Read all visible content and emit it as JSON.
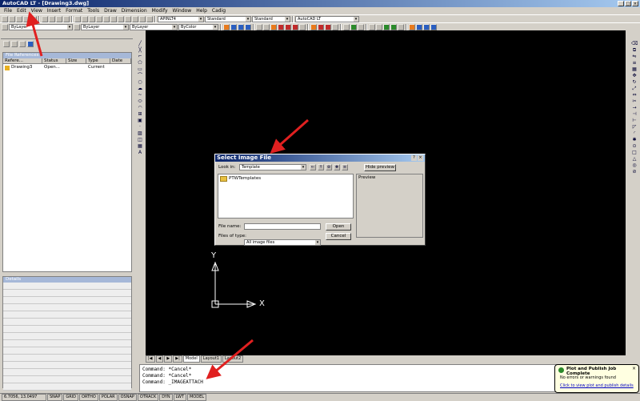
{
  "window": {
    "title": "AutoCAD LT - [Drawing3.dwg]",
    "minimize": "_",
    "maximize": "□",
    "close": "×"
  },
  "menu": [
    "File",
    "Edit",
    "View",
    "Insert",
    "Format",
    "Tools",
    "Draw",
    "Dimension",
    "Modify",
    "Window",
    "Help",
    "Cadig"
  ],
  "toolbar": {
    "layer_combo": "APINLT4",
    "text_style": "Standard",
    "dim_style": "Standard",
    "workspace": "AutoCAD LT",
    "layer_dropdown": "ByLayer",
    "linetype": "ByLayer",
    "lineweight": "ByLayer",
    "color": "ByColor"
  },
  "xref_panel": {
    "title": "File References",
    "columns": [
      "Refere...",
      "Status",
      "Size",
      "Type",
      "Date"
    ],
    "rows": [
      {
        "name": "Drawing3",
        "status": "Open...",
        "size": "",
        "type": "Current",
        "date": ""
      }
    ]
  },
  "details_panel": {
    "title": "Details"
  },
  "dialog": {
    "title": "Select Image File",
    "look_in_label": "Look in:",
    "look_in_value": "Template",
    "hide_preview": "Hide preview",
    "files": [
      "PTWTemplates"
    ],
    "preview_label": "Preview",
    "file_name_label": "File name:",
    "file_name_value": "",
    "files_of_type_label": "Files of type:",
    "files_of_type_value": "All image files",
    "open_button": "Open",
    "cancel_button": "Cancel",
    "help_btn": "?",
    "close_btn": "×"
  },
  "ucs": {
    "y": "Y",
    "x": "X"
  },
  "layout_tabs": [
    "Model",
    "Layout1",
    "Layout2"
  ],
  "command_lines": [
    "Command: *Cancel*",
    "Command: *Cancel*",
    "Command: _IMAGEATTACH"
  ],
  "status": {
    "coords": "6.7056, 13.0497",
    "toggles": [
      "SNAP",
      "GRID",
      "ORTHO",
      "POLAR",
      "OSNAP",
      "OTRACK",
      "DYN",
      "LWT",
      "MODEL"
    ]
  },
  "notification": {
    "title": "Plot and Publish Job Complete",
    "message": "No errors or warnings found",
    "link": "Click to view plot and publish details"
  },
  "colors": {
    "titlebar": "#0a246a",
    "canvas": "#000000",
    "arrow": "#e02020",
    "notification": "#ffffe1"
  }
}
